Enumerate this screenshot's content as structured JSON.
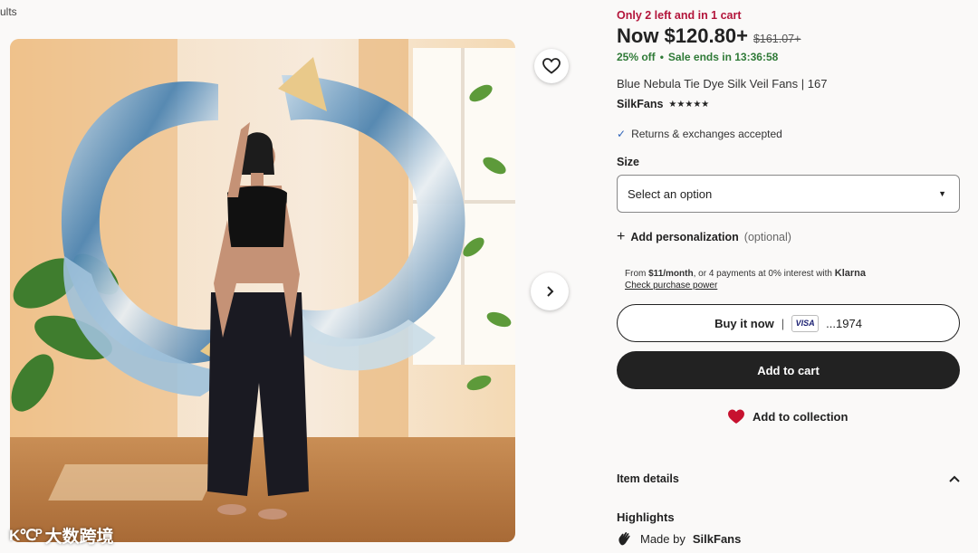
{
  "breadcrumb": {
    "text": "ults"
  },
  "product": {
    "stock_notice": "Only 2 left and in 1 cart",
    "price_now": "Now $120.80+",
    "price_original": "$161.07+",
    "discount": "25% off",
    "dot": "•",
    "sale_ends": "Sale ends in 13:36:58",
    "title": "Blue Nebula Tie Dye Silk Veil Fans | 167",
    "shop_name": "SilkFans",
    "rating_stars": "★★★★★",
    "rating": 4.5,
    "returns": "Returns & exchanges accepted"
  },
  "size": {
    "label": "Size",
    "selected": "Select an option"
  },
  "personalization": {
    "label": "Add personalization",
    "optional": "(optional)"
  },
  "klarna": {
    "from": "From",
    "amount": "$11/month",
    "middle": ", or 4 payments at 0% interest with",
    "brand": "Klarna",
    "link": "Check purchase power"
  },
  "actions": {
    "buy_now": "Buy it now",
    "separator": "|",
    "card_brand": "VISA",
    "card_last4": "...1974",
    "add_to_cart": "Add to cart",
    "add_to_collection": "Add to collection"
  },
  "sections": {
    "item_details": "Item details",
    "highlights": "Highlights",
    "made_by_prefix": "Made by",
    "made_by_shop": "SilkFans"
  },
  "watermark": {
    "logo": "K℃ᴾ",
    "text": "大数跨境"
  },
  "colors": {
    "stock_red": "#b3153b",
    "sale_green": "#2f7a37",
    "button_dark": "#222222",
    "heart_red": "#c7122f"
  }
}
